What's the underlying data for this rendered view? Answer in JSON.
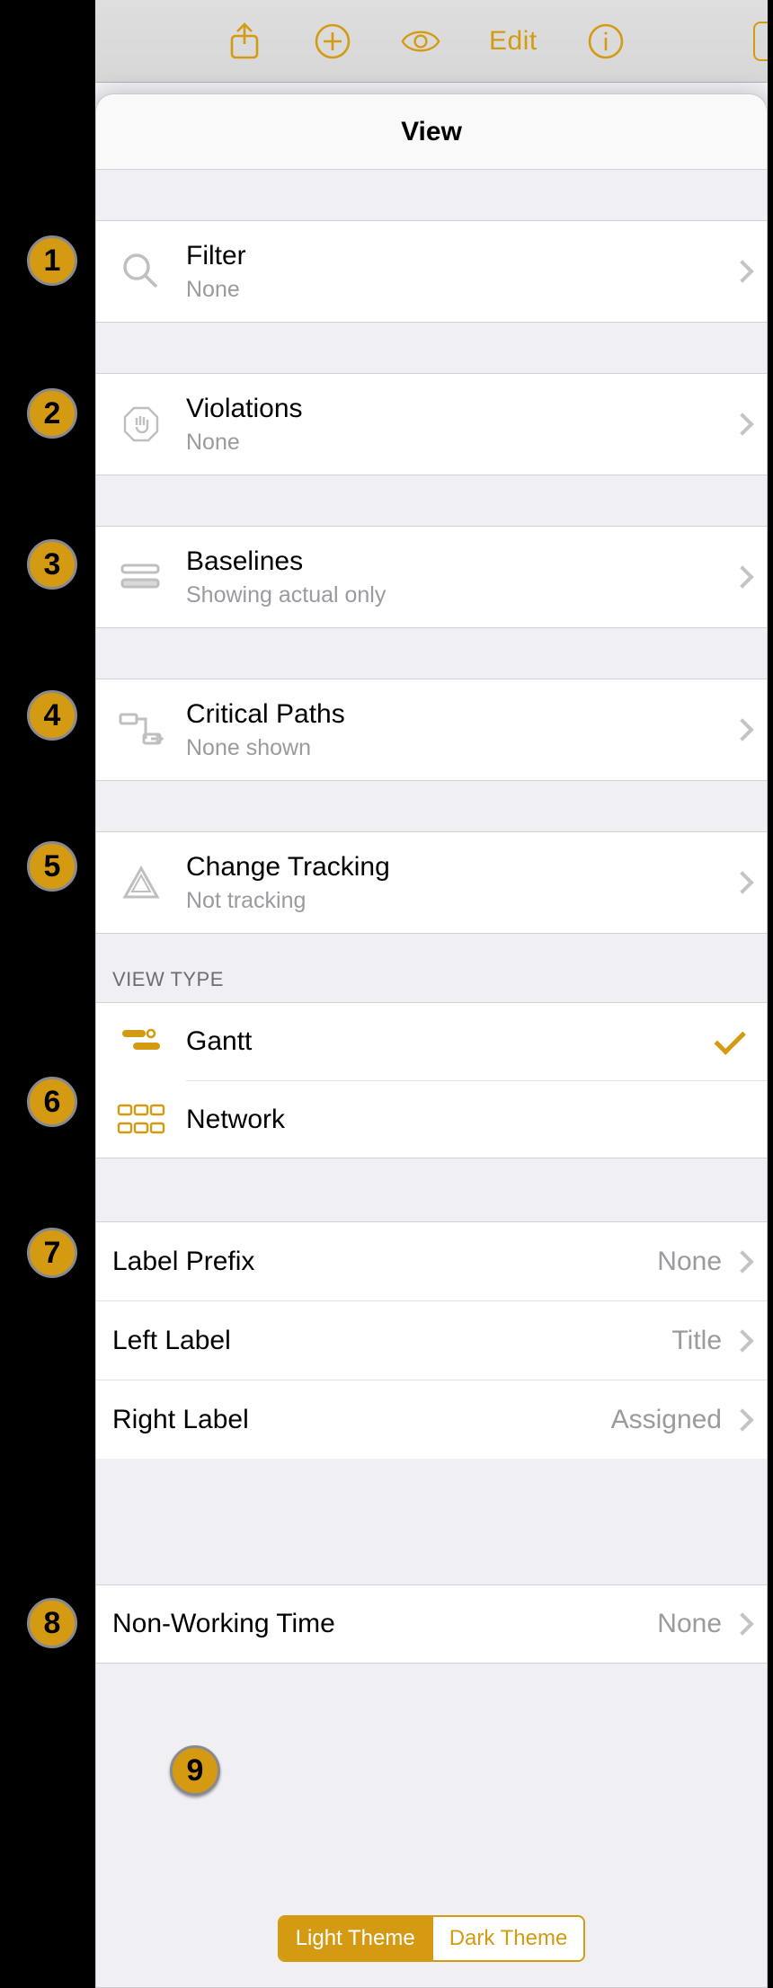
{
  "toolbar": {
    "edit_label": "Edit"
  },
  "popover": {
    "title": "View",
    "filter": {
      "label": "Filter",
      "sub": "None"
    },
    "violations": {
      "label": "Violations",
      "sub": "None"
    },
    "baselines": {
      "label": "Baselines",
      "sub": "Showing actual only"
    },
    "critical_paths": {
      "label": "Critical Paths",
      "sub": "None shown"
    },
    "change_tracking": {
      "label": "Change Tracking",
      "sub": "Not tracking"
    },
    "view_type_header": "VIEW TYPE",
    "view_type": {
      "gantt": "Gantt",
      "network": "Network"
    },
    "label_prefix": {
      "label": "Label Prefix",
      "value": "None"
    },
    "left_label": {
      "label": "Left Label",
      "value": "Title"
    },
    "right_label": {
      "label": "Right Label",
      "value": "Assigned"
    },
    "non_working": {
      "label": "Non-Working Time",
      "value": "None"
    },
    "theme": {
      "light": "Light Theme",
      "dark": "Dark Theme"
    }
  },
  "badges": [
    "1",
    "2",
    "3",
    "4",
    "5",
    "6",
    "7",
    "8",
    "9"
  ]
}
